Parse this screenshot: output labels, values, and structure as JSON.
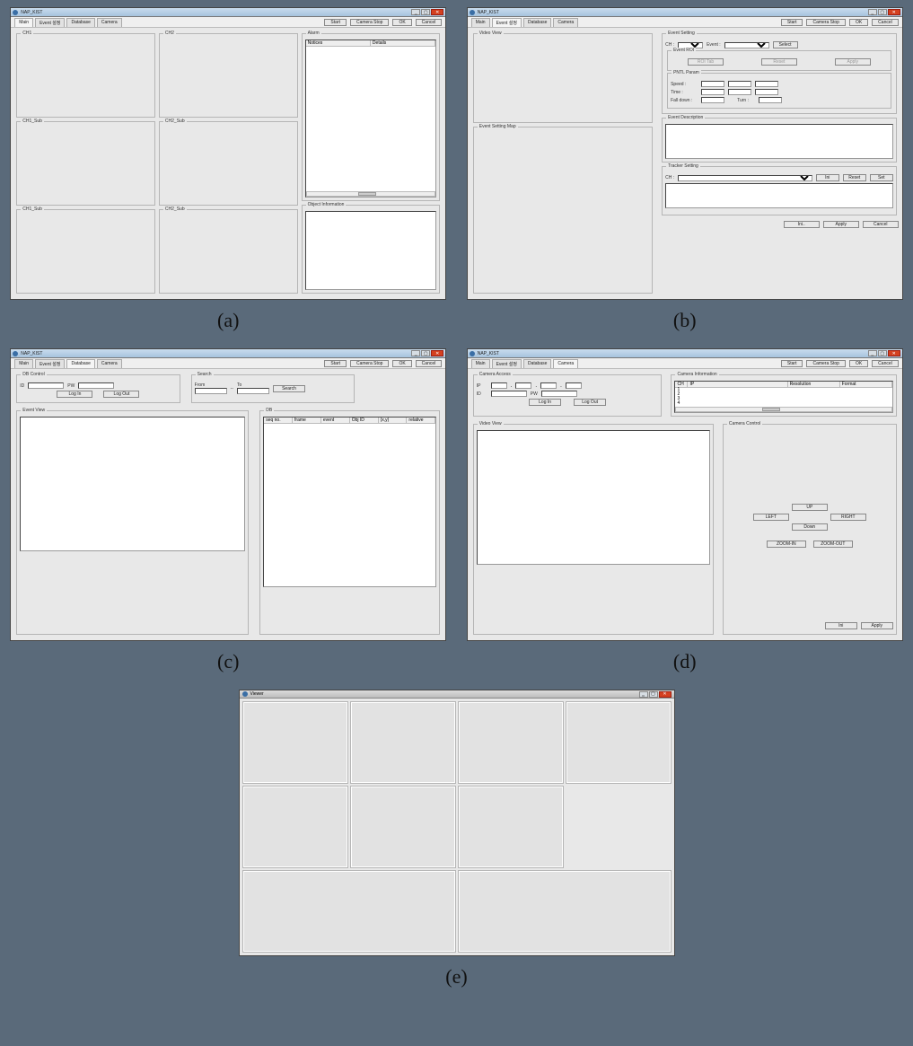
{
  "common": {
    "app_title": "NAP_KIST",
    "btn_start": "Start",
    "btn_camera_stop": "Camera Stop",
    "btn_ok": "OK",
    "btn_cancel": "Cancel",
    "tabs": [
      "Main",
      "Event 설정",
      "Database",
      "Camera"
    ]
  },
  "a": {
    "ch1": "CH1",
    "ch2": "CH2",
    "ch1_sub": "CH1_Sub",
    "ch2_sub": "CH2_Sub",
    "ch1_sub2": "CH1_Sub",
    "ch2_sub2": "CH2_Sub",
    "alarm": "Alarm",
    "alarm_cols": {
      "notices": "Notices",
      "details": "Details"
    },
    "object_info": "Object Information"
  },
  "b": {
    "video_view": "Video View",
    "event_setting_map": "Event Setting Map",
    "event_setting": "Event Setting",
    "ch_lbl": "CH :",
    "event_lbl": "Event :",
    "select": "Select",
    "event_roi": "Event ROI",
    "roi_tab": "ROI Tab",
    "reset": "Reset",
    "apply": "Apply",
    "pntl_param": "PNTL Param",
    "speed": "Speed :",
    "time": "Time :",
    "fall_down": "Fall down :",
    "turn": "Turn :",
    "event_description": "Event Description",
    "tracker_setting": "Tracker Setting",
    "ini": "Ini",
    "tracker_reset": "Reset",
    "set": "Set",
    "bottom_ini": "Ini..",
    "bottom_apply": "Apply",
    "bottom_cancel": "Cancel"
  },
  "c": {
    "db_control": "DB Control",
    "id": "ID",
    "pw": "PW",
    "login": "Log In",
    "logout": "Log Out",
    "search": "Search",
    "from": "From",
    "to": "To",
    "separator": "--",
    "search_btn": "Search",
    "event_view": "Event View",
    "db": "DB",
    "db_cols": {
      "seqno": "seq no.",
      "frame": "frame",
      "event": "event",
      "objid": "Obj ID",
      "xy": "(x,y)",
      "relative": "relative"
    }
  },
  "d": {
    "camera_access": "Camera Access",
    "ip": "IP",
    "id": "ID",
    "pw": "PW",
    "login": "Log In",
    "logout": "Log Out",
    "camera_information": "Camera Information",
    "cam_cols": {
      "ch": "CH",
      "ip": "IP",
      "resolution": "Resolution",
      "format": "Format"
    },
    "cam_rows": [
      "1",
      "2",
      "3",
      "4"
    ],
    "video_view": "Video View",
    "camera_control": "Camera Control",
    "up": "UP",
    "left": "LEFT",
    "right": "RIGHT",
    "down": "Down",
    "zoom_in": "ZOOM-IN",
    "zoom_out": "ZOOM-OUT",
    "ini": "Ini",
    "apply": "Apply"
  },
  "e": {
    "title": "Viewer"
  },
  "captions": {
    "a": "(a)",
    "b": "(b)",
    "c": "(c)",
    "d": "(d)",
    "e": "(e)"
  }
}
